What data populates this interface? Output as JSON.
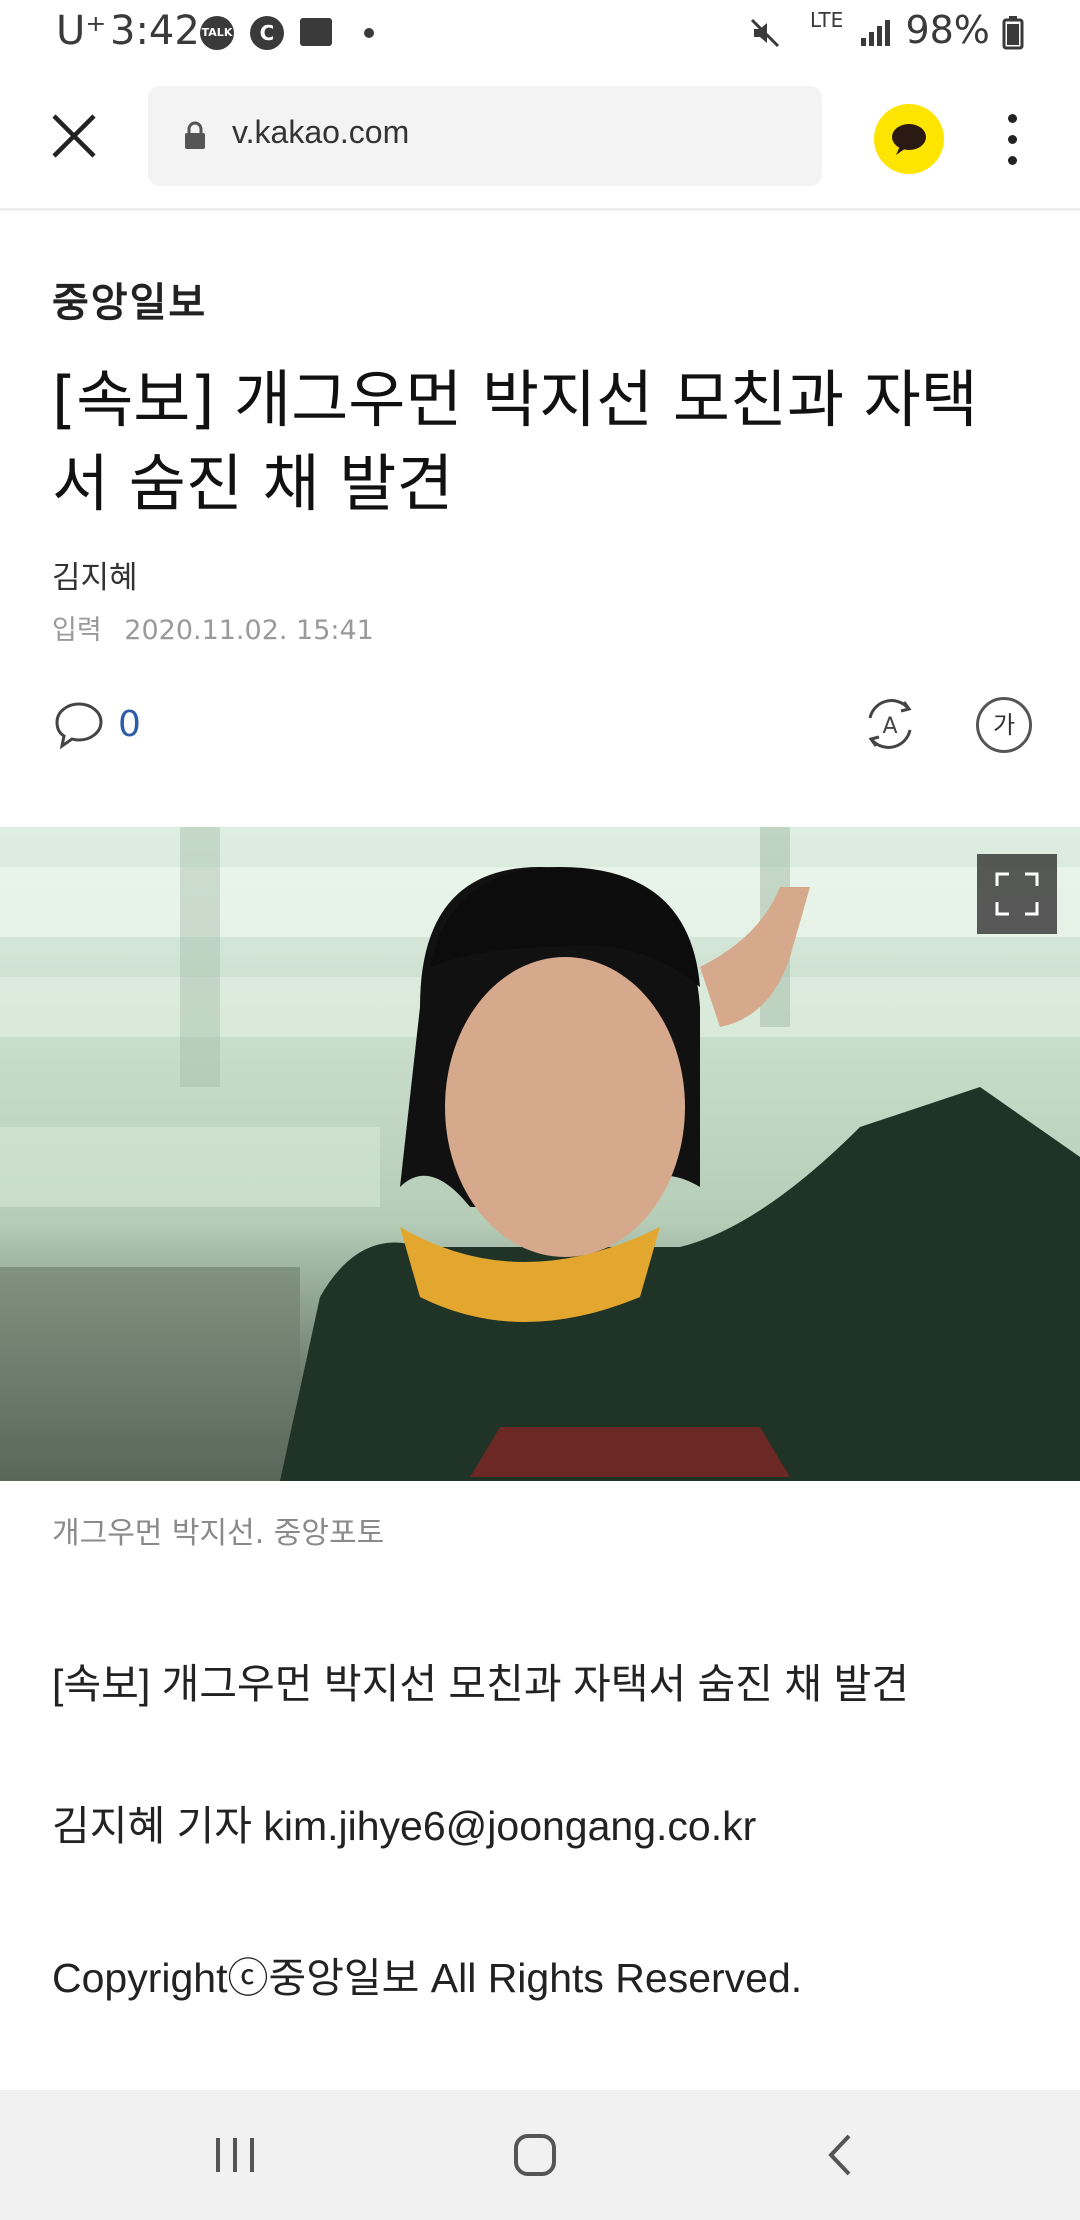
{
  "status_bar": {
    "carrier": "U⁺",
    "time": "3:42",
    "notif_talk": "TALK",
    "notif_c": "C",
    "network": "LTE",
    "battery": "98%"
  },
  "browser": {
    "url": "v.kakao.com"
  },
  "article": {
    "press": "중앙일보",
    "headline": "[속보] 개그우먼 박지선 모친과 자택서 숨진 채 발견",
    "author": "김지혜",
    "date_label": "입력",
    "date": "2020.11.02. 15:41",
    "comment_count": "0",
    "font_size_label": "가",
    "photo_caption": "개그우먼 박지선. 중앙포토",
    "body": [
      "[속보] 개그우먼 박지선 모친과 자택서 숨진 채 발견",
      "김지혜 기자 kim.jihye6@joongang.co.kr",
      "Copyrightⓒ중앙일보 All Rights Reserved."
    ]
  },
  "colors": {
    "kakao_yellow": "#fee500",
    "comment_blue": "#2e5ca8"
  },
  "icons": [
    "close-icon",
    "lock-icon",
    "kakaotalk-icon",
    "more-icon",
    "comment-icon",
    "translate-icon",
    "expand-icon",
    "recent-apps-icon",
    "home-icon",
    "back-icon"
  ]
}
